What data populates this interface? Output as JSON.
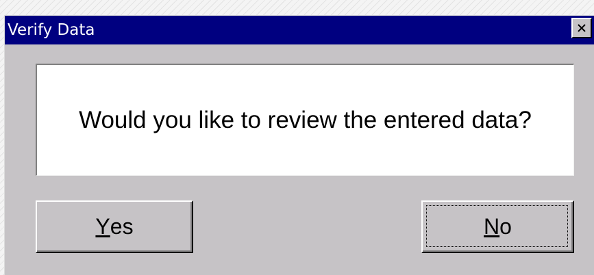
{
  "dialog": {
    "title": "Verify Data",
    "close_label": "×",
    "message": "Would you like to review the entered data?",
    "buttons": {
      "yes": {
        "mnemonic": "Y",
        "rest": "es"
      },
      "no": {
        "mnemonic": "N",
        "rest": "o",
        "focused": true
      }
    }
  },
  "colors": {
    "titlebar": "#000080",
    "dialog_face": "#c6c3c6",
    "message_background": "#ffffff"
  },
  "icons": {
    "close": "close-icon"
  }
}
